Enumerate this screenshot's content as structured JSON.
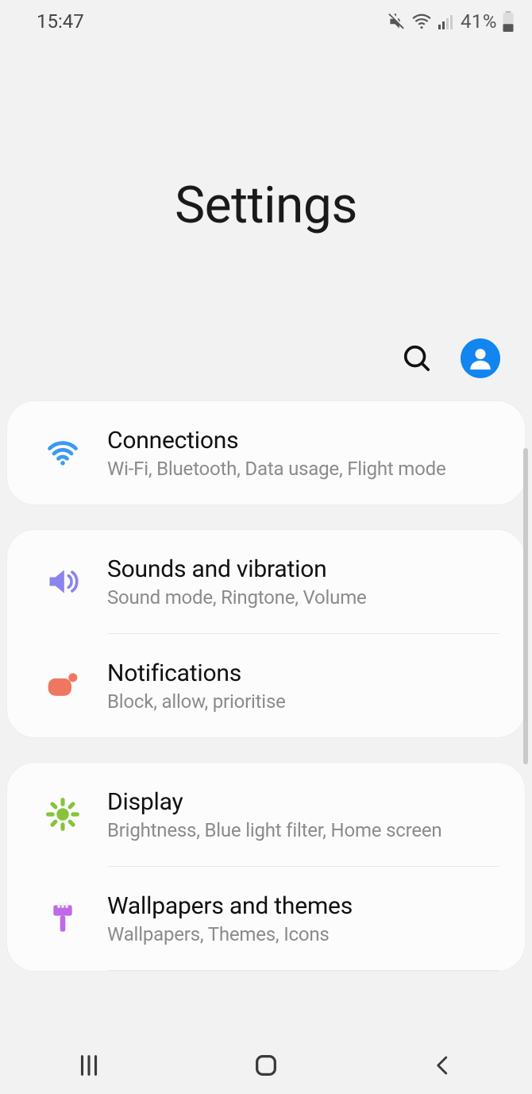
{
  "status": {
    "time": "15:47",
    "battery_percent": "41%"
  },
  "header": {
    "title": "Settings"
  },
  "groups": [
    {
      "items": [
        {
          "icon": "wifi",
          "title": "Connections",
          "subtitle": "Wi-Fi, Bluetooth, Data usage, Flight mode"
        }
      ]
    },
    {
      "items": [
        {
          "icon": "sound",
          "title": "Sounds and vibration",
          "subtitle": "Sound mode, Ringtone, Volume"
        },
        {
          "icon": "notif",
          "title": "Notifications",
          "subtitle": "Block, allow, prioritise"
        }
      ]
    },
    {
      "items": [
        {
          "icon": "display",
          "title": "Display",
          "subtitle": "Brightness, Blue light filter, Home screen"
        },
        {
          "icon": "theme",
          "title": "Wallpapers and themes",
          "subtitle": "Wallpapers, Themes, Icons"
        }
      ]
    }
  ]
}
